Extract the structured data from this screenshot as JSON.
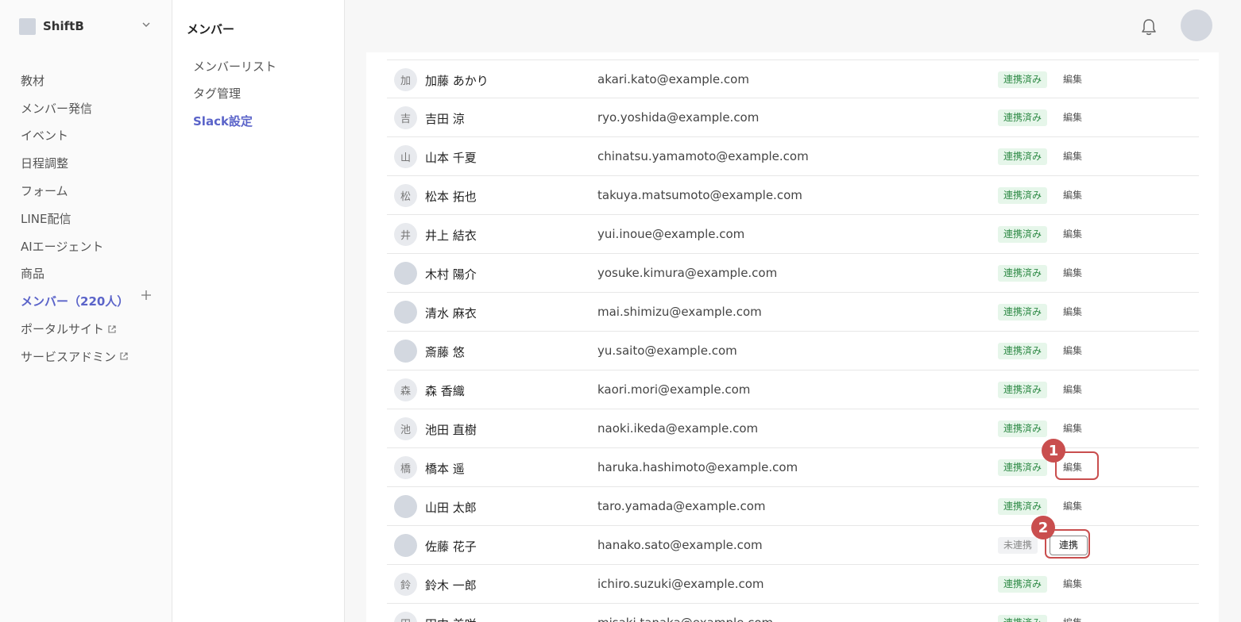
{
  "app": {
    "brand": "ShiftB",
    "nav": [
      {
        "label": "教材",
        "active": false,
        "external": false
      },
      {
        "label": "メンバー発信",
        "active": false,
        "external": false
      },
      {
        "label": "イベント",
        "active": false,
        "external": false
      },
      {
        "label": "日程調整",
        "active": false,
        "external": false
      },
      {
        "label": "フォーム",
        "active": false,
        "external": false
      },
      {
        "label": "LINE配信",
        "active": false,
        "external": false
      },
      {
        "label": "AIエージェント",
        "active": false,
        "external": false
      },
      {
        "label": "商品",
        "active": false,
        "external": false
      },
      {
        "label": "メンバー（220人）",
        "active": true,
        "external": false
      },
      {
        "label": "ポータルサイト",
        "active": false,
        "external": true
      },
      {
        "label": "サービスアドミン",
        "active": false,
        "external": true
      }
    ]
  },
  "subnav": {
    "title": "メンバー",
    "items": [
      {
        "label": "メンバーリスト",
        "active": false
      },
      {
        "label": "タグ管理",
        "active": false
      },
      {
        "label": "Slack設定",
        "active": true
      }
    ]
  },
  "table": {
    "rows": [
      {
        "initial": "加",
        "name": "加藤 あかり",
        "email": "akari.kato@example.com",
        "status": "連携済み",
        "action": "編集"
      },
      {
        "initial": "吉",
        "name": "吉田 涼",
        "email": "ryo.yoshida@example.com",
        "status": "連携済み",
        "action": "編集"
      },
      {
        "initial": "山",
        "name": "山本 千夏",
        "email": "chinatsu.yamamoto@example.com",
        "status": "連携済み",
        "action": "編集"
      },
      {
        "initial": "松",
        "name": "松本 拓也",
        "email": "takuya.matsumoto@example.com",
        "status": "連携済み",
        "action": "編集"
      },
      {
        "initial": "井",
        "name": "井上 結衣",
        "email": "yui.inoue@example.com",
        "status": "連携済み",
        "action": "編集"
      },
      {
        "initial": "",
        "name": "木村 陽介",
        "email": "yosuke.kimura@example.com",
        "status": "連携済み",
        "action": "編集"
      },
      {
        "initial": "",
        "name": "清水 麻衣",
        "email": "mai.shimizu@example.com",
        "status": "連携済み",
        "action": "編集"
      },
      {
        "initial": "",
        "name": "斎藤 悠",
        "email": "yu.saito@example.com",
        "status": "連携済み",
        "action": "編集"
      },
      {
        "initial": "森",
        "name": "森 香織",
        "email": "kaori.mori@example.com",
        "status": "連携済み",
        "action": "編集"
      },
      {
        "initial": "池",
        "name": "池田 直樹",
        "email": "naoki.ikeda@example.com",
        "status": "連携済み",
        "action": "編集"
      },
      {
        "initial": "橋",
        "name": "橋本 遥",
        "email": "haruka.hashimoto@example.com",
        "status": "連携済み",
        "action": "編集"
      },
      {
        "initial": "",
        "name": "山田 太郎",
        "email": "taro.yamada@example.com",
        "status": "連携済み",
        "action": "編集"
      },
      {
        "initial": "",
        "name": "佐藤 花子",
        "email": "hanako.sato@example.com",
        "status": "未連携",
        "action": "連携"
      },
      {
        "initial": "鈴",
        "name": "鈴木 一郎",
        "email": "ichiro.suzuki@example.com",
        "status": "連携済み",
        "action": "編集"
      },
      {
        "initial": "田",
        "name": "田中 美咲",
        "email": "misaki.tanaka@example.com",
        "status": "連携済み",
        "action": "編集"
      }
    ]
  },
  "annotations": [
    {
      "number": "1",
      "target": "橋本 遥 / 編集"
    },
    {
      "number": "2",
      "target": "佐藤 花子 / 連携"
    }
  ],
  "colors": {
    "accent": "#5b64c9",
    "linked_bg": "#e6f6ea",
    "linked_text": "#2f8a46",
    "highlight": "#c94e4e"
  }
}
